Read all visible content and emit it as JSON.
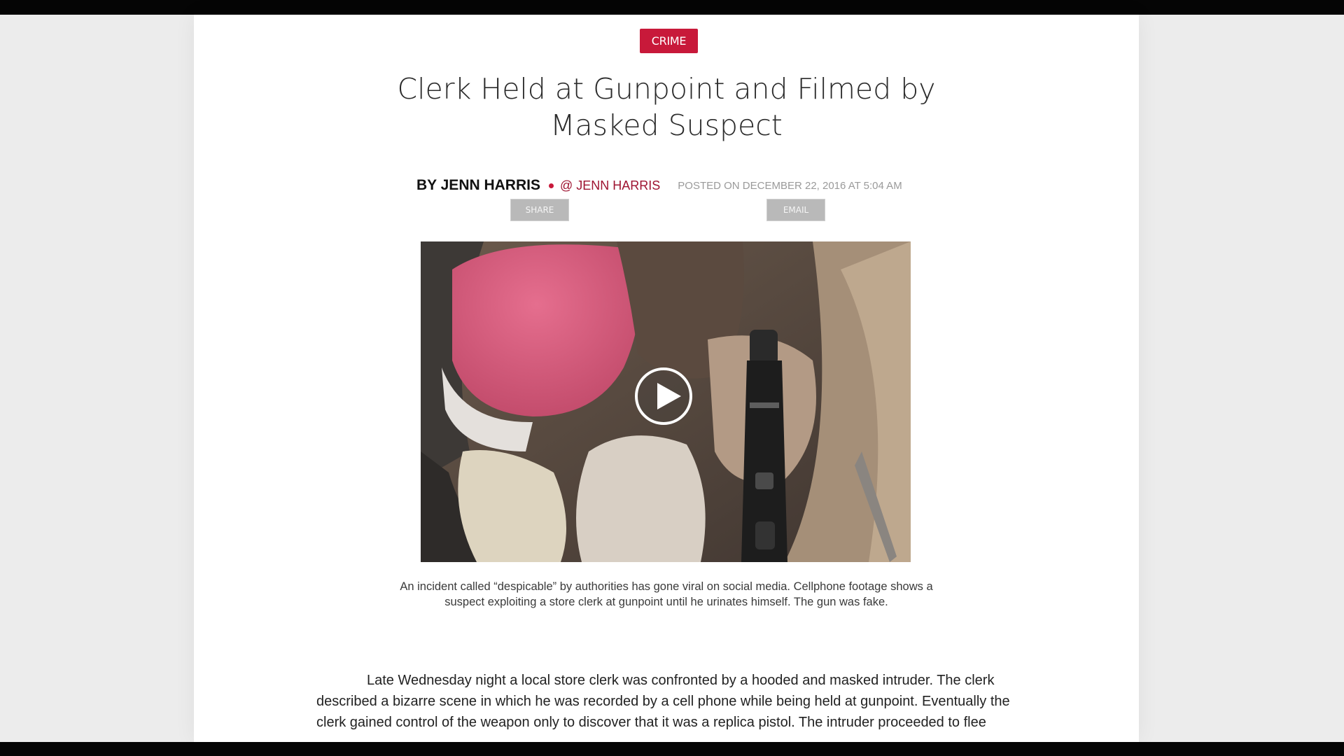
{
  "article": {
    "category": "CRIME",
    "headline": "Clerk Held at Gunpoint and Filmed by Masked Suspect",
    "author": "BY JENN HARRIS",
    "twitter_handle": "@ JENN HARRIS",
    "posted": "POSTED ON DECEMBER 22, 2016 AT 5:04 AM",
    "share_label": "SHARE",
    "email_label": "EMAIL",
    "caption": "An incident called “despicable” by authorities has gone viral on social media. Cellphone footage shows a suspect exploiting a store clerk at gunpoint until he urinates himself. The gun was fake.",
    "body": "Late Wednesday night a local store clerk was confronted by a hooded and masked intruder. The clerk described a bizarre scene in which he was recorded by a cell phone while being held at gunpoint. Eventually the clerk gained control of the weapon only to discover that it was a replica pistol. The intruder proceeded to flee"
  },
  "icons": {
    "video_play": "play-icon"
  },
  "colors": {
    "accent": "#c8193a",
    "handle": "#9e1330",
    "background": "#ececec"
  }
}
